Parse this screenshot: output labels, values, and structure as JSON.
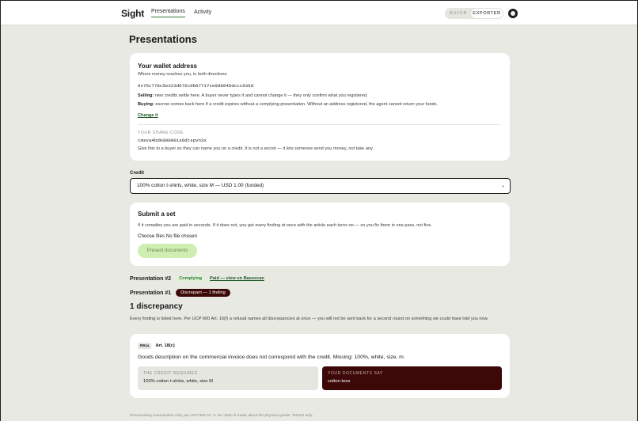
{
  "nav": {
    "logo": "Sight",
    "tabs": [
      {
        "label": "Presentations"
      },
      {
        "label": "Activity"
      }
    ],
    "roles": [
      "BUYER",
      "EXPORTER"
    ],
    "selected_role": "EXPORTER"
  },
  "page": {
    "title": "Presentations"
  },
  "wallet": {
    "title": "Your wallet address",
    "subtitle": "Where money reaches you, in both directions.",
    "address": "0x75c778c5e323d676c0b67717ce9d9045dccc635d",
    "selling_label": "Selling:",
    "selling_text": " new credits settle here. A buyer never types it and cannot change it — they only confirm what you registered.",
    "buying_label": "Buying:",
    "buying_text": " escrow comes back here if a credit expires without a complying presentation. Without an address registered, the agent cannot return your funds.",
    "change_link": "Change it",
    "share_code_label": "YOUR SHARE CODE",
    "share_code": "cmsva4bdk000001s6dtspvn3x",
    "share_code_hint": "Give this to a buyer so they can name you on a credit. It is not a secret — it lets someone send you money, not take any."
  },
  "credit": {
    "label": "Credit",
    "selected": "100% cotton t-shirts, white, size M — USD 1.00 (funded)"
  },
  "submit": {
    "title": "Submit a set",
    "text": "If it complies you are paid in seconds. If it does not, you get every finding at once with the article each turns on — so you fix them in one pass, not five.",
    "file_button": "Choose files",
    "file_status": "No file chosen",
    "present_button": "Present documents"
  },
  "presentations": [
    {
      "label": "Presentation #2",
      "status": "Complying",
      "link": "Paid — view on Basescan"
    },
    {
      "label": "Presentation #1",
      "status": "Discrepant — 1 finding"
    }
  ],
  "discrepancy": {
    "title": "1 discrepancy",
    "text": "Every finding is listed here. Per UCP 600 Art. 16(f) a refusal names all discrepancies at once — you will not be sent back for a second round on something we could have told you now.",
    "finding": {
      "code": "R61a",
      "article": "Art. 18(c)",
      "message": "Goods description on the commercial invoice does not correspond with the credit. Missing: 100%, white, size, m.",
      "requires_label": "THE CREDIT REQUIRES",
      "requires_value": "100% cotton t-shirts, white, size M",
      "says_label": "YOUR DOCUMENTS SAY",
      "says_value": "cotton tees"
    }
  },
  "footer": {
    "text": "Documentary examination only, per UCP 600 Art. 5. No claim is made about the physical goods. Testnet only."
  },
  "colors": {
    "accent": "#2f7a3a",
    "danger": "#3d0808",
    "background": "#e9e9e4"
  }
}
